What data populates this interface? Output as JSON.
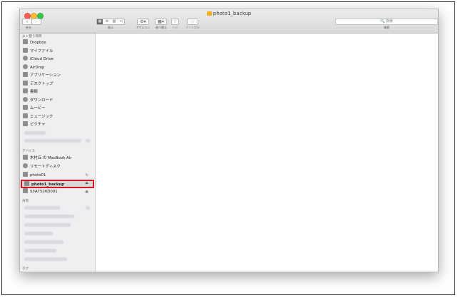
{
  "window": {
    "title": "photo1_backup",
    "traffic_lights": {
      "close": "#fc5f57",
      "minimize": "#fdbc2e",
      "zoom": "#33c748"
    }
  },
  "toolbar": {
    "back_label": "戻る",
    "view_label": "表示",
    "action_label": "アクション",
    "arrange_label": "並べ替え",
    "share_label": "共有",
    "tags_label": "タグを編集",
    "search_label": "検索",
    "search_placeholder": "検索"
  },
  "sidebar": {
    "favorites_header": "よく使う項目",
    "favorites": [
      {
        "label": "Dropbox",
        "icon": "dropbox-icon"
      },
      {
        "label": "マイファイル",
        "icon": "all-my-files-icon"
      },
      {
        "label": "iCloud Drive",
        "icon": "cloud-icon"
      },
      {
        "label": "AirDrop",
        "icon": "airdrop-icon"
      },
      {
        "label": "アプリケーション",
        "icon": "applications-icon"
      },
      {
        "label": "デスクトップ",
        "icon": "desktop-icon"
      },
      {
        "label": "書類",
        "icon": "documents-icon"
      },
      {
        "label": "ダウンロード",
        "icon": "download-icon"
      },
      {
        "label": "ムービー",
        "icon": "movies-icon"
      },
      {
        "label": "ミュージック",
        "icon": "music-icon"
      },
      {
        "label": "ピクチャ",
        "icon": "pictures-icon"
      }
    ],
    "devices_header": "デバイス",
    "devices": [
      {
        "label": "木村丘 の MacBook Air",
        "icon": "laptop-icon"
      },
      {
        "label": "リモートディスク",
        "icon": "remote-disc-icon"
      },
      {
        "label": "photo01",
        "icon": "disk-icon",
        "badge": "sync-icon"
      },
      {
        "label": "photo1_backup",
        "icon": "disk-icon",
        "badge": "eject-icon",
        "selected": true
      },
      {
        "label": "S3A7526D001",
        "icon": "disk-icon",
        "badge": "eject-icon"
      }
    ],
    "shared_header": "共有",
    "tags_header": "タグ",
    "highlight_color": "#d8161f"
  }
}
